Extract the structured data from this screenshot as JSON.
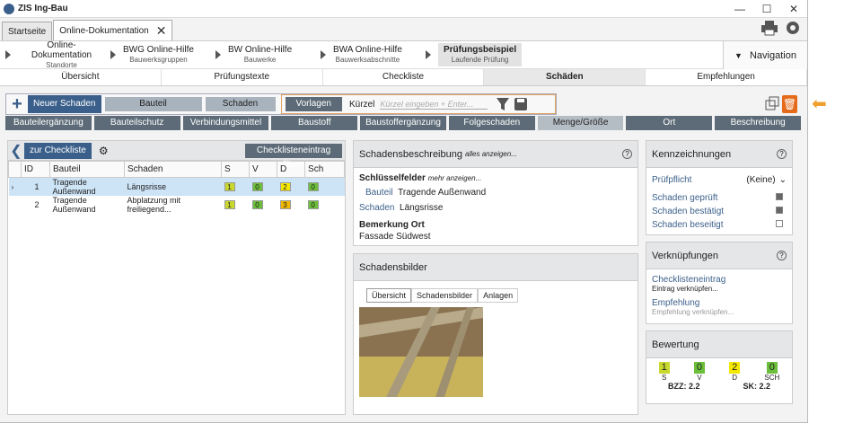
{
  "app": {
    "title": "ZIS Ing-Bau"
  },
  "tabs": [
    "Startseite",
    "Online-Dokumentation"
  ],
  "breadcrumb": [
    {
      "t1": "Online-Dokumentation",
      "t2": "Standorte"
    },
    {
      "t1": "BWG Online-Hilfe",
      "t2": "Bauwerksgruppen"
    },
    {
      "t1": "BW Online-Hilfe",
      "t2": "Bauwerke"
    },
    {
      "t1": "BWA Online-Hilfe",
      "t2": "Bauwerksabschnitte"
    },
    {
      "t1": "Prüfungsbeispiel",
      "t2": "Laufende Prüfung"
    }
  ],
  "navigation": "Navigation",
  "subtabs": [
    "Übersicht",
    "Prüfungstexte",
    "Checkliste",
    "Schäden",
    "Empfehlungen"
  ],
  "toolbar": {
    "new": "Neuer Schaden",
    "bauteil": "Bauteil",
    "schaden": "Schaden",
    "vorlagen": "Vorlagen",
    "kurzel": "Kürzel",
    "kurzel_placeholder": "Kürzel eingeben + Enter..."
  },
  "categories": [
    "Bauteilergänzung",
    "Bauteilschutz",
    "Verbindungsmittel",
    "Baustoff",
    "Baustoffergänzung",
    "Folgeschaden",
    "Menge/Größe",
    "Ort",
    "Beschreibung"
  ],
  "left": {
    "back": "zur Checkliste",
    "filter": "Checklisteneintrag filtern",
    "columns": [
      "ID",
      "Bauteil",
      "Schaden",
      "S",
      "V",
      "D",
      "Sch"
    ],
    "rows": [
      {
        "id": "1",
        "bauteil": "Tragende Außenwand",
        "schaden": "Längsrisse",
        "s": "1",
        "v": "0",
        "d": "2",
        "sch": "0"
      },
      {
        "id": "2",
        "bauteil": "Tragende Außenwand",
        "schaden": "Abplatzung mit freiliegend...",
        "s": "1",
        "v": "0",
        "d": "3",
        "sch": "0"
      }
    ]
  },
  "desc": {
    "title": "Schadensbeschreibung",
    "more": "alles anzeigen...",
    "keys": "Schlüsselfelder",
    "keys_more": "mehr anzeigen...",
    "bauteil_l": "Bauteil",
    "bauteil_v": "Tragende Außenwand",
    "schaden_l": "Schaden",
    "schaden_v": "Längsrisse",
    "bem_l": "Bemerkung Ort",
    "bem_v": "Fassade Südwest"
  },
  "images": {
    "title": "Schadensbilder",
    "tabs": [
      "Übersicht",
      "Schadensbilder",
      "Anlagen"
    ]
  },
  "kenn": {
    "title": "Kennzeichnungen",
    "pruef": "Prüfpflicht",
    "pruef_val": "(Keine)",
    "items": [
      "Schaden geprüft",
      "Schaden bestätigt",
      "Schaden beseitigt"
    ]
  },
  "verk": {
    "title": "Verknüpfungen",
    "c_l": "Checklisteneintrag",
    "c_v": "Eintrag verknüpfen...",
    "e_l": "Empfehlung",
    "e_v": "Empfehlung verknüpfen..."
  },
  "bew": {
    "title": "Bewertung",
    "vals": [
      "1",
      "0",
      "2",
      "0"
    ],
    "labels": [
      "S",
      "V",
      "D",
      "SCH"
    ],
    "bzz": "BZZ: 2.2",
    "sk": "SK: 2.2"
  }
}
